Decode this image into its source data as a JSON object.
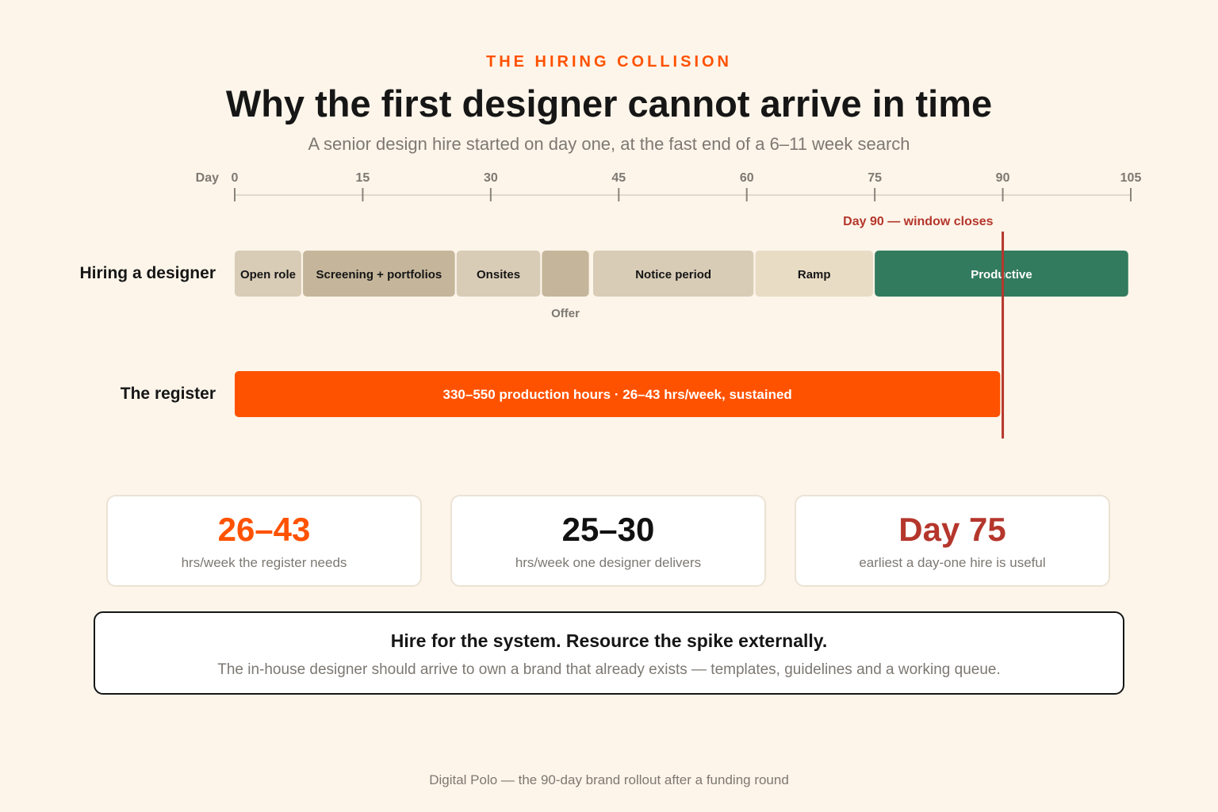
{
  "header": {
    "eyebrow": "THE HIRING COLLISION",
    "title": "Why the first designer cannot arrive in time",
    "subtitle": "A senior design hire started on day one, at the fast end of a 6–11 week search"
  },
  "axis": {
    "label": "Day",
    "ticks": [
      0,
      15,
      30,
      45,
      60,
      75,
      90,
      105
    ],
    "range": [
      0,
      105
    ]
  },
  "deadline": {
    "day": 90,
    "label": "Day 90 — window closes",
    "color": "#b5362c"
  },
  "rows": {
    "hiring": {
      "label": "Hiring a designer",
      "phases": [
        {
          "name": "open-role",
          "label": "Open role",
          "start": 0,
          "end": 7.8,
          "color": "#d9ccb6",
          "text_color": "#161616"
        },
        {
          "name": "screening",
          "label": "Screening + portfolios",
          "start": 8,
          "end": 25.8,
          "color": "#c5b69b",
          "text_color": "#161616"
        },
        {
          "name": "onsites",
          "label": "Onsites",
          "start": 26,
          "end": 35.8,
          "color": "#d9ccb6",
          "text_color": "#161616"
        },
        {
          "name": "offer",
          "label": "",
          "start": 36,
          "end": 41.5,
          "color": "#c5b69b",
          "text_color": "#161616"
        },
        {
          "name": "notice-period",
          "label": "Notice period",
          "start": 42,
          "end": 60.8,
          "color": "#d9ccb6",
          "text_color": "#161616"
        },
        {
          "name": "ramp",
          "label": "Ramp",
          "start": 61,
          "end": 74.8,
          "color": "#e9dcc5",
          "text_color": "#161616"
        },
        {
          "name": "productive",
          "label": "Productive",
          "start": 75,
          "end": 104.7,
          "color": "#327b5e",
          "text_color": "#ffffff"
        }
      ],
      "offer_note": {
        "label": "Offer",
        "day": 38.75
      }
    },
    "register": {
      "label": "The register",
      "bar_label": "330–550 production hours · 26–43 hrs/week, sustained",
      "start": 0,
      "end": 89.7,
      "color": "#ff5200"
    }
  },
  "stats": [
    {
      "value": "26–43",
      "caption": "hrs/week the register needs",
      "color": "#ff5200"
    },
    {
      "value": "25–30",
      "caption": "hrs/week one designer delivers",
      "color": "#111111"
    },
    {
      "value": "Day 75",
      "caption": "earliest a day-one hire is useful",
      "color": "#b5362c"
    }
  ],
  "callout": {
    "headline": "Hire for the system. Resource the spike externally.",
    "body": "The in-house designer should arrive to own a brand that already exists — templates, guidelines and a working queue."
  },
  "footer": "Digital Polo — the 90-day brand rollout after a funding round"
}
